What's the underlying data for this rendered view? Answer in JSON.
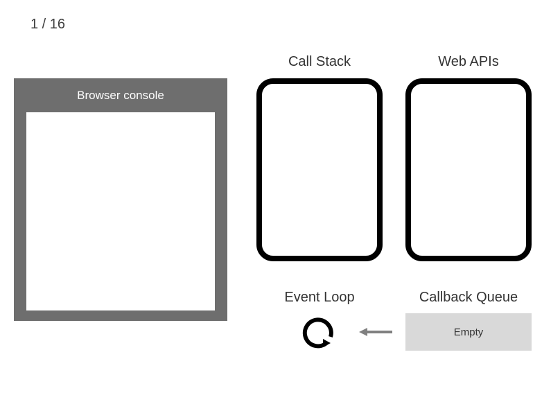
{
  "step": {
    "current": 1,
    "total": 16,
    "display": "1 / 16"
  },
  "console": {
    "title": "Browser console"
  },
  "callstack": {
    "title": "Call Stack"
  },
  "webapis": {
    "title": "Web APIs"
  },
  "eventloop": {
    "title": "Event Loop"
  },
  "cbqueue": {
    "title": "Callback Queue",
    "content": "Empty"
  },
  "colors": {
    "panel_gray": "#6e6e6e",
    "queue_gray": "#d9d9d9",
    "arrow_gray": "#808080"
  }
}
